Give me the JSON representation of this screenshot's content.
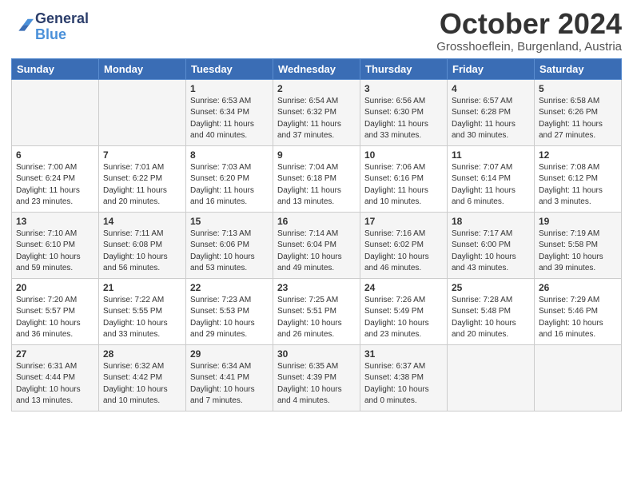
{
  "header": {
    "logo_general": "General",
    "logo_blue": "Blue",
    "month_title": "October 2024",
    "location": "Grosshoeflein, Burgenland, Austria"
  },
  "days_of_week": [
    "Sunday",
    "Monday",
    "Tuesday",
    "Wednesday",
    "Thursday",
    "Friday",
    "Saturday"
  ],
  "weeks": [
    [
      {
        "day": "",
        "info": ""
      },
      {
        "day": "",
        "info": ""
      },
      {
        "day": "1",
        "info": "Sunrise: 6:53 AM\nSunset: 6:34 PM\nDaylight: 11 hours and 40 minutes."
      },
      {
        "day": "2",
        "info": "Sunrise: 6:54 AM\nSunset: 6:32 PM\nDaylight: 11 hours and 37 minutes."
      },
      {
        "day": "3",
        "info": "Sunrise: 6:56 AM\nSunset: 6:30 PM\nDaylight: 11 hours and 33 minutes."
      },
      {
        "day": "4",
        "info": "Sunrise: 6:57 AM\nSunset: 6:28 PM\nDaylight: 11 hours and 30 minutes."
      },
      {
        "day": "5",
        "info": "Sunrise: 6:58 AM\nSunset: 6:26 PM\nDaylight: 11 hours and 27 minutes."
      }
    ],
    [
      {
        "day": "6",
        "info": "Sunrise: 7:00 AM\nSunset: 6:24 PM\nDaylight: 11 hours and 23 minutes."
      },
      {
        "day": "7",
        "info": "Sunrise: 7:01 AM\nSunset: 6:22 PM\nDaylight: 11 hours and 20 minutes."
      },
      {
        "day": "8",
        "info": "Sunrise: 7:03 AM\nSunset: 6:20 PM\nDaylight: 11 hours and 16 minutes."
      },
      {
        "day": "9",
        "info": "Sunrise: 7:04 AM\nSunset: 6:18 PM\nDaylight: 11 hours and 13 minutes."
      },
      {
        "day": "10",
        "info": "Sunrise: 7:06 AM\nSunset: 6:16 PM\nDaylight: 11 hours and 10 minutes."
      },
      {
        "day": "11",
        "info": "Sunrise: 7:07 AM\nSunset: 6:14 PM\nDaylight: 11 hours and 6 minutes."
      },
      {
        "day": "12",
        "info": "Sunrise: 7:08 AM\nSunset: 6:12 PM\nDaylight: 11 hours and 3 minutes."
      }
    ],
    [
      {
        "day": "13",
        "info": "Sunrise: 7:10 AM\nSunset: 6:10 PM\nDaylight: 10 hours and 59 minutes."
      },
      {
        "day": "14",
        "info": "Sunrise: 7:11 AM\nSunset: 6:08 PM\nDaylight: 10 hours and 56 minutes."
      },
      {
        "day": "15",
        "info": "Sunrise: 7:13 AM\nSunset: 6:06 PM\nDaylight: 10 hours and 53 minutes."
      },
      {
        "day": "16",
        "info": "Sunrise: 7:14 AM\nSunset: 6:04 PM\nDaylight: 10 hours and 49 minutes."
      },
      {
        "day": "17",
        "info": "Sunrise: 7:16 AM\nSunset: 6:02 PM\nDaylight: 10 hours and 46 minutes."
      },
      {
        "day": "18",
        "info": "Sunrise: 7:17 AM\nSunset: 6:00 PM\nDaylight: 10 hours and 43 minutes."
      },
      {
        "day": "19",
        "info": "Sunrise: 7:19 AM\nSunset: 5:58 PM\nDaylight: 10 hours and 39 minutes."
      }
    ],
    [
      {
        "day": "20",
        "info": "Sunrise: 7:20 AM\nSunset: 5:57 PM\nDaylight: 10 hours and 36 minutes."
      },
      {
        "day": "21",
        "info": "Sunrise: 7:22 AM\nSunset: 5:55 PM\nDaylight: 10 hours and 33 minutes."
      },
      {
        "day": "22",
        "info": "Sunrise: 7:23 AM\nSunset: 5:53 PM\nDaylight: 10 hours and 29 minutes."
      },
      {
        "day": "23",
        "info": "Sunrise: 7:25 AM\nSunset: 5:51 PM\nDaylight: 10 hours and 26 minutes."
      },
      {
        "day": "24",
        "info": "Sunrise: 7:26 AM\nSunset: 5:49 PM\nDaylight: 10 hours and 23 minutes."
      },
      {
        "day": "25",
        "info": "Sunrise: 7:28 AM\nSunset: 5:48 PM\nDaylight: 10 hours and 20 minutes."
      },
      {
        "day": "26",
        "info": "Sunrise: 7:29 AM\nSunset: 5:46 PM\nDaylight: 10 hours and 16 minutes."
      }
    ],
    [
      {
        "day": "27",
        "info": "Sunrise: 6:31 AM\nSunset: 4:44 PM\nDaylight: 10 hours and 13 minutes."
      },
      {
        "day": "28",
        "info": "Sunrise: 6:32 AM\nSunset: 4:42 PM\nDaylight: 10 hours and 10 minutes."
      },
      {
        "day": "29",
        "info": "Sunrise: 6:34 AM\nSunset: 4:41 PM\nDaylight: 10 hours and 7 minutes."
      },
      {
        "day": "30",
        "info": "Sunrise: 6:35 AM\nSunset: 4:39 PM\nDaylight: 10 hours and 4 minutes."
      },
      {
        "day": "31",
        "info": "Sunrise: 6:37 AM\nSunset: 4:38 PM\nDaylight: 10 hours and 0 minutes."
      },
      {
        "day": "",
        "info": ""
      },
      {
        "day": "",
        "info": ""
      }
    ]
  ]
}
